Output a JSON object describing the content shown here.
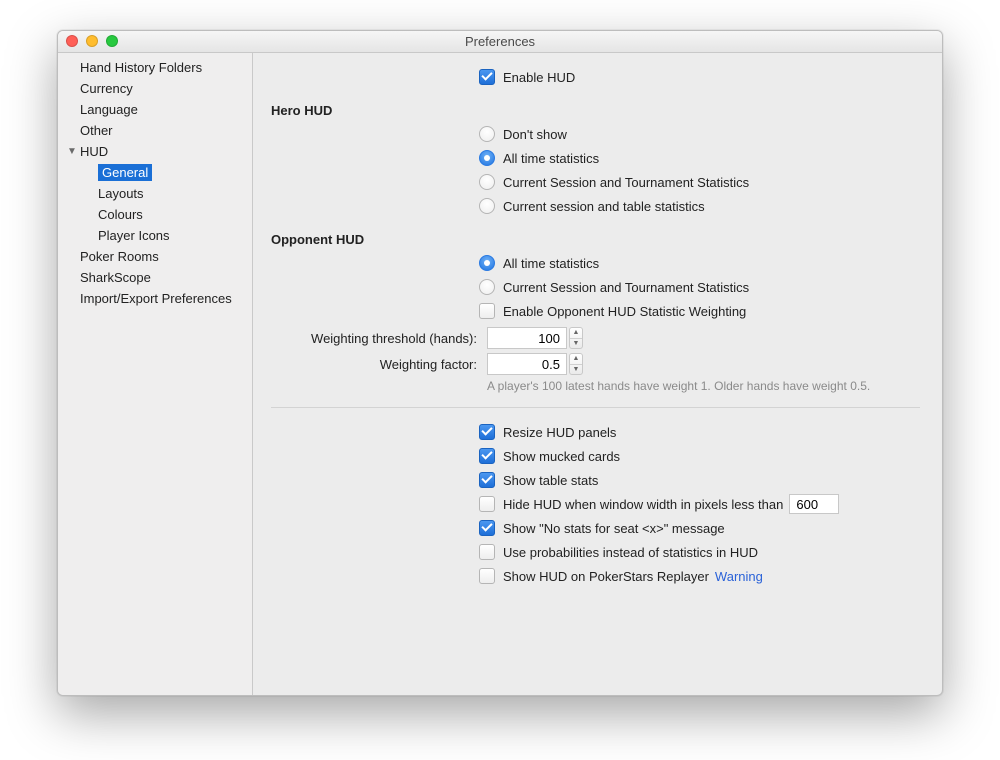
{
  "window": {
    "title": "Preferences"
  },
  "sidebar": {
    "items": [
      {
        "label": "Hand History Folders"
      },
      {
        "label": "Currency"
      },
      {
        "label": "Language"
      },
      {
        "label": "Other"
      },
      {
        "label": "HUD",
        "expanded": true,
        "children": [
          {
            "label": "General",
            "selected": true
          },
          {
            "label": "Layouts"
          },
          {
            "label": "Colours"
          },
          {
            "label": "Player Icons"
          }
        ]
      },
      {
        "label": "Poker Rooms"
      },
      {
        "label": "SharkScope"
      },
      {
        "label": "Import/Export Preferences"
      }
    ]
  },
  "main": {
    "enable_hud_label": "Enable HUD",
    "hero_section": "Hero HUD",
    "hero_options": [
      "Don't show",
      "All time statistics",
      "Current Session and Tournament Statistics",
      "Current session and table statistics"
    ],
    "hero_selected": 1,
    "opponent_section": "Opponent HUD",
    "opponent_options": [
      "All time statistics",
      "Current Session and Tournament Statistics"
    ],
    "opponent_selected": 0,
    "enable_weighting_label": "Enable Opponent HUD Statistic Weighting",
    "threshold_label": "Weighting threshold (hands):",
    "threshold_value": "100",
    "factor_label": "Weighting factor:",
    "factor_value": "0.5",
    "weighting_note": "A player's 100 latest hands have weight 1. Older hands have weight 0.5.",
    "options": {
      "resize": "Resize HUD panels",
      "mucked": "Show mucked cards",
      "table_stats": "Show table stats",
      "hide_width": "Hide HUD when window width in pixels less than",
      "hide_width_value": "600",
      "no_stats_msg": "Show \"No stats for seat <x>\" message",
      "use_prob": "Use probabilities instead of statistics in HUD",
      "replayer": "Show HUD on PokerStars Replayer",
      "replayer_warn": "Warning"
    }
  }
}
